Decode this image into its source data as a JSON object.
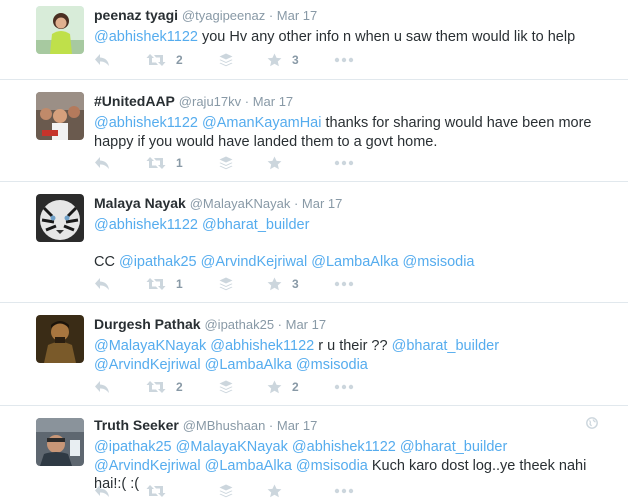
{
  "tweets": [
    {
      "fullname": "peenaz tyagi",
      "handle": "@tyagipeenaz",
      "sep": " · ",
      "time": "Mar 17",
      "text": [
        {
          "t": "@abhishek1122",
          "m": true
        },
        {
          "t": " you Hv any other info n when u saw them would lik to help",
          "m": false
        }
      ],
      "retweets": "2",
      "favorites": "3"
    },
    {
      "fullname": "#UnitedAAP",
      "handle": "@raju17kv",
      "sep": " · ",
      "time": "Mar 17",
      "text": [
        {
          "t": "@abhishek1122",
          "m": true
        },
        {
          "t": " ",
          "m": false
        },
        {
          "t": "@AmanKayamHai",
          "m": true
        },
        {
          "t": " thanks for sharing would have been more happy if you would have landed them to a govt home.",
          "m": false
        }
      ],
      "retweets": "1",
      "favorites": ""
    },
    {
      "fullname": "Malaya Nayak",
      "handle": "@MalayaKNayak",
      "sep": " · ",
      "time": "Mar 17",
      "text": [
        {
          "t": "@abhishek1122",
          "m": true
        },
        {
          "t": " ",
          "m": false
        },
        {
          "t": "@bharat_builder",
          "m": true
        },
        {
          "br": true
        },
        {
          "br": true
        },
        {
          "t": "CC ",
          "m": false
        },
        {
          "t": "@ipathak25",
          "m": true
        },
        {
          "t": " ",
          "m": false
        },
        {
          "t": "@ArvindKejriwal",
          "m": true
        },
        {
          "t": " ",
          "m": false
        },
        {
          "t": "@LambaAlka",
          "m": true
        },
        {
          "t": " ",
          "m": false
        },
        {
          "t": "@msisodia",
          "m": true
        }
      ],
      "retweets": "1",
      "favorites": "3"
    },
    {
      "fullname": "Durgesh Pathak",
      "handle": "@ipathak25",
      "sep": " · ",
      "time": "Mar 17",
      "text": [
        {
          "t": "@MalayaKNayak",
          "m": true
        },
        {
          "t": " ",
          "m": false
        },
        {
          "t": "@abhishek1122",
          "m": true
        },
        {
          "t": "  r u their ?? ",
          "m": false
        },
        {
          "t": "@bharat_builder",
          "m": true
        },
        {
          "t": " ",
          "m": false
        },
        {
          "t": "@ArvindKejriwal",
          "m": true
        },
        {
          "t": " ",
          "m": false
        },
        {
          "t": "@LambaAlka",
          "m": true
        },
        {
          "t": " ",
          "m": false
        },
        {
          "t": "@msisodia",
          "m": true
        }
      ],
      "retweets": "2",
      "favorites": "2"
    },
    {
      "fullname": "Truth Seeker",
      "handle": "@MBhushaan",
      "sep": " · ",
      "time": "Mar 17",
      "text": [
        {
          "t": "@ipathak25",
          "m": true
        },
        {
          "t": " ",
          "m": false
        },
        {
          "t": "@MalayaKNayak",
          "m": true
        },
        {
          "t": " ",
          "m": false
        },
        {
          "t": "@abhishek1122",
          "m": true
        },
        {
          "t": " ",
          "m": false
        },
        {
          "t": "@bharat_builder",
          "m": true
        },
        {
          "t": " ",
          "m": false
        },
        {
          "t": "@ArvindKejriwal",
          "m": true
        },
        {
          "t": " ",
          "m": false
        },
        {
          "t": "@LambaAlka",
          "m": true
        },
        {
          "t": " ",
          "m": false
        },
        {
          "t": "@msisodia",
          "m": true
        },
        {
          "t": " Kuch karo dost log..ye theek nahi hai!:( :(",
          "m": false
        }
      ],
      "retweets": "",
      "favorites": ""
    }
  ],
  "colors": {
    "mention": "#55acee",
    "name": "#292f33",
    "meta": "#8899a6",
    "icon": "#ccd6dd",
    "divider": "#e1e8ed"
  },
  "icons": {
    "reply": "reply-icon",
    "retweet": "retweet-icon",
    "buffer": "stack-icon",
    "favorite": "star-icon",
    "more": "more-dots-icon",
    "globe": "globe-icon"
  }
}
